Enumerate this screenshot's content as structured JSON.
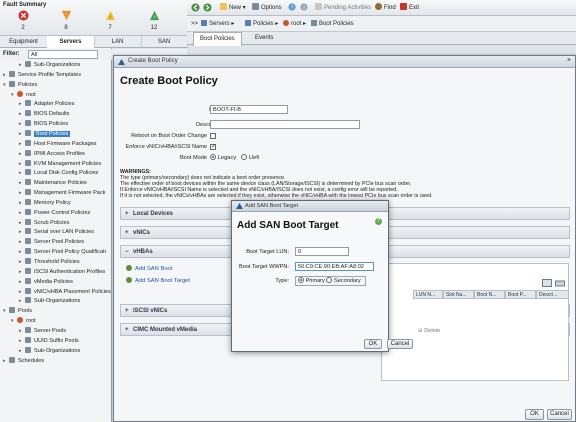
{
  "fault_summary": {
    "title": "Fault Summary",
    "items": [
      {
        "icon": "critical-icon",
        "count": "2",
        "color": "#d0312d"
      },
      {
        "icon": "major-icon",
        "count": "8",
        "color": "#f08a24"
      },
      {
        "icon": "minor-icon",
        "count": "7",
        "color": "#f2c12e"
      },
      {
        "icon": "warning-icon",
        "count": "12",
        "color": "#3f9e4d"
      }
    ]
  },
  "nav_tabs": [
    "Equipment",
    "Servers",
    "LAN",
    "SAN"
  ],
  "nav_active_tab": "Servers",
  "filter": {
    "label": "Filter:",
    "value": "All"
  },
  "tree": [
    {
      "label": "Sub-Organizations",
      "indent": 2,
      "arrow": "▸"
    },
    {
      "label": "Service Profile Templates",
      "indent": 0,
      "arrow": "▸"
    },
    {
      "label": "Policies",
      "indent": 0,
      "arrow": "▾"
    },
    {
      "label": "root",
      "indent": 1,
      "arrow": "▾"
    },
    {
      "label": "Adapter Policies",
      "indent": 2,
      "arrow": "▸"
    },
    {
      "label": "BIOS Defaults",
      "indent": 2,
      "arrow": "▸"
    },
    {
      "label": "BIOS Policies",
      "indent": 2,
      "arrow": "▸"
    },
    {
      "label": "Boot Policies",
      "indent": 2,
      "arrow": "▸",
      "selected": true
    },
    {
      "label": "Host Firmware Packages",
      "indent": 2,
      "arrow": "▸"
    },
    {
      "label": "IPMI Access Profiles",
      "indent": 2,
      "arrow": "▸"
    },
    {
      "label": "KVM Management Policies",
      "indent": 2,
      "arrow": "▸"
    },
    {
      "label": "Local Disk Config Policies",
      "indent": 2,
      "arrow": "▸"
    },
    {
      "label": "Maintenance Policies",
      "indent": 2,
      "arrow": "▸"
    },
    {
      "label": "Management Firmware Pack",
      "indent": 2,
      "arrow": "▸"
    },
    {
      "label": "Memory Policy",
      "indent": 2,
      "arrow": "▸"
    },
    {
      "label": "Power Control Policies",
      "indent": 2,
      "arrow": "▸"
    },
    {
      "label": "Scrub Policies",
      "indent": 2,
      "arrow": "▸"
    },
    {
      "label": "Serial over LAN Policies",
      "indent": 2,
      "arrow": "▸"
    },
    {
      "label": "Server Pool Policies",
      "indent": 2,
      "arrow": "▸"
    },
    {
      "label": "Server Pool Policy Qualificati",
      "indent": 2,
      "arrow": "▸"
    },
    {
      "label": "Threshold Policies",
      "indent": 2,
      "arrow": "▸"
    },
    {
      "label": "iSCSI Authentication Profiles",
      "indent": 2,
      "arrow": "▸"
    },
    {
      "label": "vMedia Policies",
      "indent": 2,
      "arrow": "▸"
    },
    {
      "label": "vNIC/vHBA Placement Policies",
      "indent": 2,
      "arrow": "▸"
    },
    {
      "label": "Sub-Organizations",
      "indent": 2,
      "arrow": "▸"
    },
    {
      "label": "Pools",
      "indent": 0,
      "arrow": "▾"
    },
    {
      "label": "root",
      "indent": 1,
      "arrow": "▾"
    },
    {
      "label": "Server Pools",
      "indent": 2,
      "arrow": "▸"
    },
    {
      "label": "UUID Suffix Pools",
      "indent": 2,
      "arrow": "▸"
    },
    {
      "label": "Sub-Organizations",
      "indent": 2,
      "arrow": "▸"
    },
    {
      "label": "Schedules",
      "indent": 0,
      "arrow": "▸"
    }
  ],
  "toolbar": {
    "new": "New",
    "options": "Options",
    "pending": "Pending Activities",
    "find": "Find",
    "exit": "Exit"
  },
  "breadcrumb": [
    "Servers",
    "Policies",
    "root",
    "Boot Policies"
  ],
  "content_tabs": [
    "Boot Policies",
    "Events"
  ],
  "create_dialog": {
    "window_title": "Create Boot Policy",
    "heading": "Create Boot Policy",
    "name_label": "Name",
    "name_value": "BOOT-FI-B",
    "description_label": "Description",
    "description_value": "",
    "reboot_label": "Reboot on Boot Order Change",
    "reboot_checked": false,
    "enforce_label": "Enforce vNIC/vHBA/iSCSI Name",
    "enforce_checked": true,
    "boot_mode_label": "Boot Mode",
    "boot_mode_options": [
      "Legacy",
      "Uefi"
    ],
    "boot_mode_selected": "Legacy",
    "warnings_title": "WARNINGS:",
    "warnings": [
      "The type (primary/secondary) does not indicate a boot order presence.",
      "The effective order of boot devices within the same device class (LAN/Storage/iSCSI) is determined by PCIe bus scan order.",
      "If Enforce vNIC/vHBA/iSCSI Name is selected and the vNIC/vHBA/iSCSI does not exist, a config error will be reported.",
      "If it is not selected, the vNICs/vHBAs are selected if they exist, otherwise the vNIC/vHBA with the lowest PCIe bus scan order is used."
    ],
    "sections": [
      "Local Devices",
      "vNICs",
      "vHBAs",
      "iSCSI vNICs",
      "CIMC Mounted vMedia"
    ],
    "vhba_links": [
      "Add SAN Boot",
      "Add SAN Boot Target"
    ],
    "grid_headers": [
      "LUN N...",
      "Slot Nu...",
      "Boot N...",
      "Boot P...",
      "Descri..."
    ],
    "delete_label": "Delete",
    "ok": "OK",
    "cancel": "Cancel"
  },
  "san_dialog": {
    "window_title": "Add SAN Boot Target",
    "heading": "Add SAN Boot Target",
    "help": "?",
    "lun_label": "Boot Target LUN:",
    "lun_value": "0",
    "wwpn_label": "Boot Target WWPN:",
    "wwpn_value": "50:C9:CE:90:EB:AF:A8:02",
    "type_label": "Type:",
    "type_options": [
      "Primary",
      "Secondary"
    ],
    "type_selected": "Primary",
    "ok": "OK",
    "cancel": "Cancel"
  },
  "colors": {
    "accent": "#3d7fc8",
    "link": "#2155a7"
  }
}
